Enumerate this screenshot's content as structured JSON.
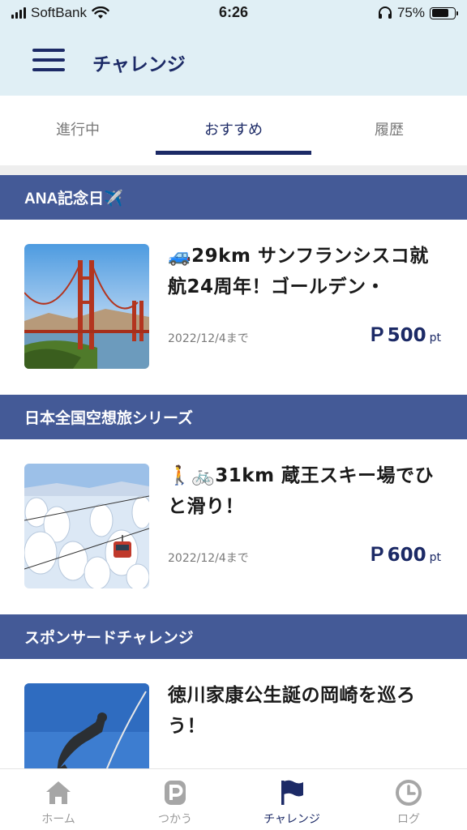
{
  "status_bar": {
    "carrier": "SoftBank",
    "time": "6:26",
    "battery_percent": "75%",
    "battery_level": 0.75,
    "icons": [
      "signal-icon",
      "wifi-icon",
      "headphones-icon",
      "battery-icon"
    ]
  },
  "header": {
    "title": "チャレンジ",
    "menu_icon": "hamburger-menu-icon"
  },
  "tabs": [
    {
      "label": "進行中",
      "active": false
    },
    {
      "label": "おすすめ",
      "active": true
    },
    {
      "label": "履歴",
      "active": false
    }
  ],
  "sections": [
    {
      "title": "ANA記念日✈️",
      "card": {
        "title": "🚙29km サンフランシスコ就航24周年！ゴールデン・",
        "date": "2022/12/4まで",
        "points_mark": "P",
        "points": "500",
        "points_unit": "pt",
        "image": "golden-gate-bridge-photo"
      }
    },
    {
      "title": "日本全国空想旅シリーズ",
      "card": {
        "title": "🚶🚲31km 蔵王スキー場でひと滑り！",
        "date": "2022/12/4まで",
        "points_mark": "P",
        "points": "600",
        "points_unit": "pt",
        "image": "zao-snow-ropeway-photo"
      }
    },
    {
      "title": "スポンサードチャレンジ",
      "card": {
        "title": "徳川家康公生誕の岡崎を巡ろう！",
        "image": "tokugawa-statue-photo"
      }
    }
  ],
  "bottom_nav": [
    {
      "label": "ホーム",
      "icon": "home-icon",
      "active": false
    },
    {
      "label": "つかう",
      "icon": "points-p-icon",
      "active": false
    },
    {
      "label": "チャレンジ",
      "icon": "flag-icon",
      "active": true
    },
    {
      "label": "ログ",
      "icon": "clock-icon",
      "active": false
    }
  ],
  "colors": {
    "navy": "#1c2a66",
    "section": "#445a97",
    "header_bg": "#e0eff5"
  }
}
